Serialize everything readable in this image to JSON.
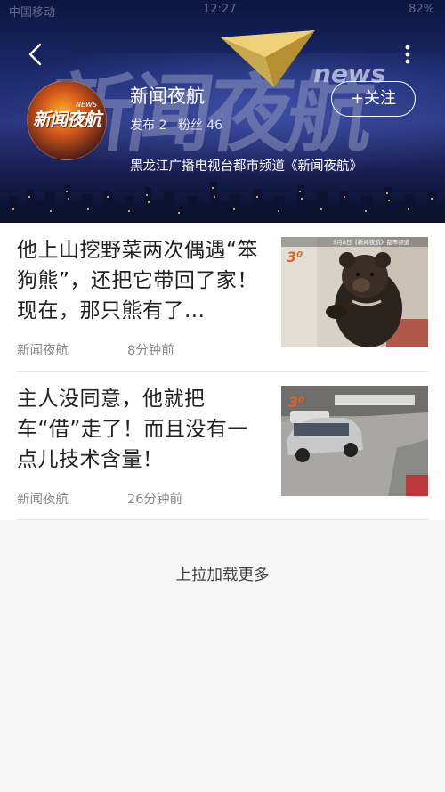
{
  "status_bar": {
    "left": "中国移动",
    "time": "12:27",
    "right": "82%"
  },
  "header": {
    "banner_title": "新闻夜航",
    "banner_news": "news",
    "avatar_title": "新闻夜航",
    "avatar_news": "NEWS",
    "channel_name": "新闻夜航",
    "posts_label": "发布 2",
    "fans_label": "粉丝 46",
    "follow_label": "+关注",
    "description": "黑龙江广播电视台都市频道《新闻夜航》"
  },
  "articles": [
    {
      "title": "他上山挖野菜两次偶遇“笨狗熊”，还把它带回了家！现在，那只熊有了...",
      "source": "新闻夜航",
      "time": "8分钟前",
      "thumb_caption": "5月8日《新闻夜航》都市频道"
    },
    {
      "title": "主人没同意，他就把车“借”走了！而且没有一点儿技术含量！",
      "source": "新闻夜航",
      "time": "26分钟前",
      "thumb_caption": ""
    }
  ],
  "load_more": "上拉加载更多",
  "colors": {
    "accent_orange": "#e0632a",
    "text_secondary": "#888888"
  }
}
